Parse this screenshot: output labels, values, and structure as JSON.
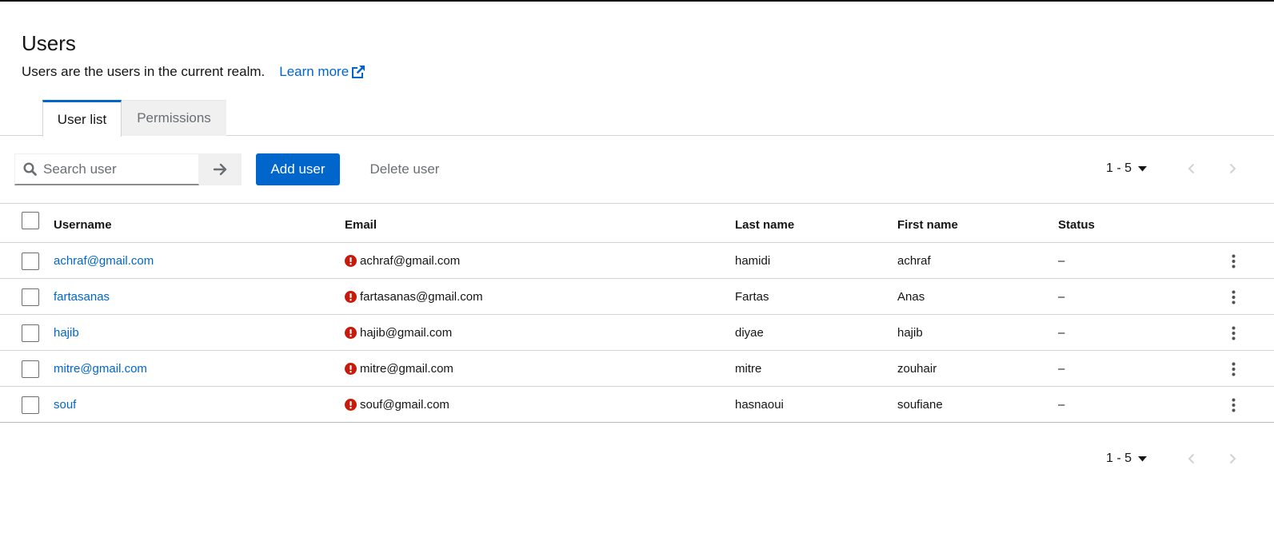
{
  "page": {
    "title": "Users",
    "description": "Users are the users in the current realm.",
    "learn_more": "Learn more"
  },
  "tabs": [
    {
      "label": "User list",
      "active": true
    },
    {
      "label": "Permissions",
      "active": false
    }
  ],
  "toolbar": {
    "search_placeholder": "Search user",
    "add_user": "Add user",
    "delete_user": "Delete user"
  },
  "pagination": {
    "range": "1 - 5"
  },
  "table": {
    "columns": {
      "username": "Username",
      "email": "Email",
      "last_name": "Last name",
      "first_name": "First name",
      "status": "Status"
    },
    "rows": [
      {
        "username": "achraf@gmail.com",
        "email": "achraf@gmail.com",
        "last_name": "hamidi",
        "first_name": "achraf",
        "status": "–"
      },
      {
        "username": "fartasanas",
        "email": "fartasanas@gmail.com",
        "last_name": "Fartas",
        "first_name": "Anas",
        "status": "–"
      },
      {
        "username": "hajib",
        "email": "hajib@gmail.com",
        "last_name": "diyae",
        "first_name": "hajib",
        "status": "–"
      },
      {
        "username": "mitre@gmail.com",
        "email": "mitre@gmail.com",
        "last_name": "mitre",
        "first_name": "zouhair",
        "status": "–"
      },
      {
        "username": "souf",
        "email": "souf@gmail.com",
        "last_name": "hasnaoui",
        "first_name": "soufiane",
        "status": "–"
      }
    ]
  },
  "colors": {
    "accent": "#0066cc",
    "warning_icon": "#c9190b",
    "border": "#d2d2d2"
  },
  "icons": {
    "search": "search-icon",
    "external_link": "external-link-icon",
    "arrow_right": "arrow-right-icon",
    "caret_down": "caret-down-icon",
    "chevron_left": "chevron-left-icon",
    "chevron_right": "chevron-right-icon",
    "unverified": "exclamation-circle-icon",
    "kebab": "kebab-menu-icon"
  }
}
